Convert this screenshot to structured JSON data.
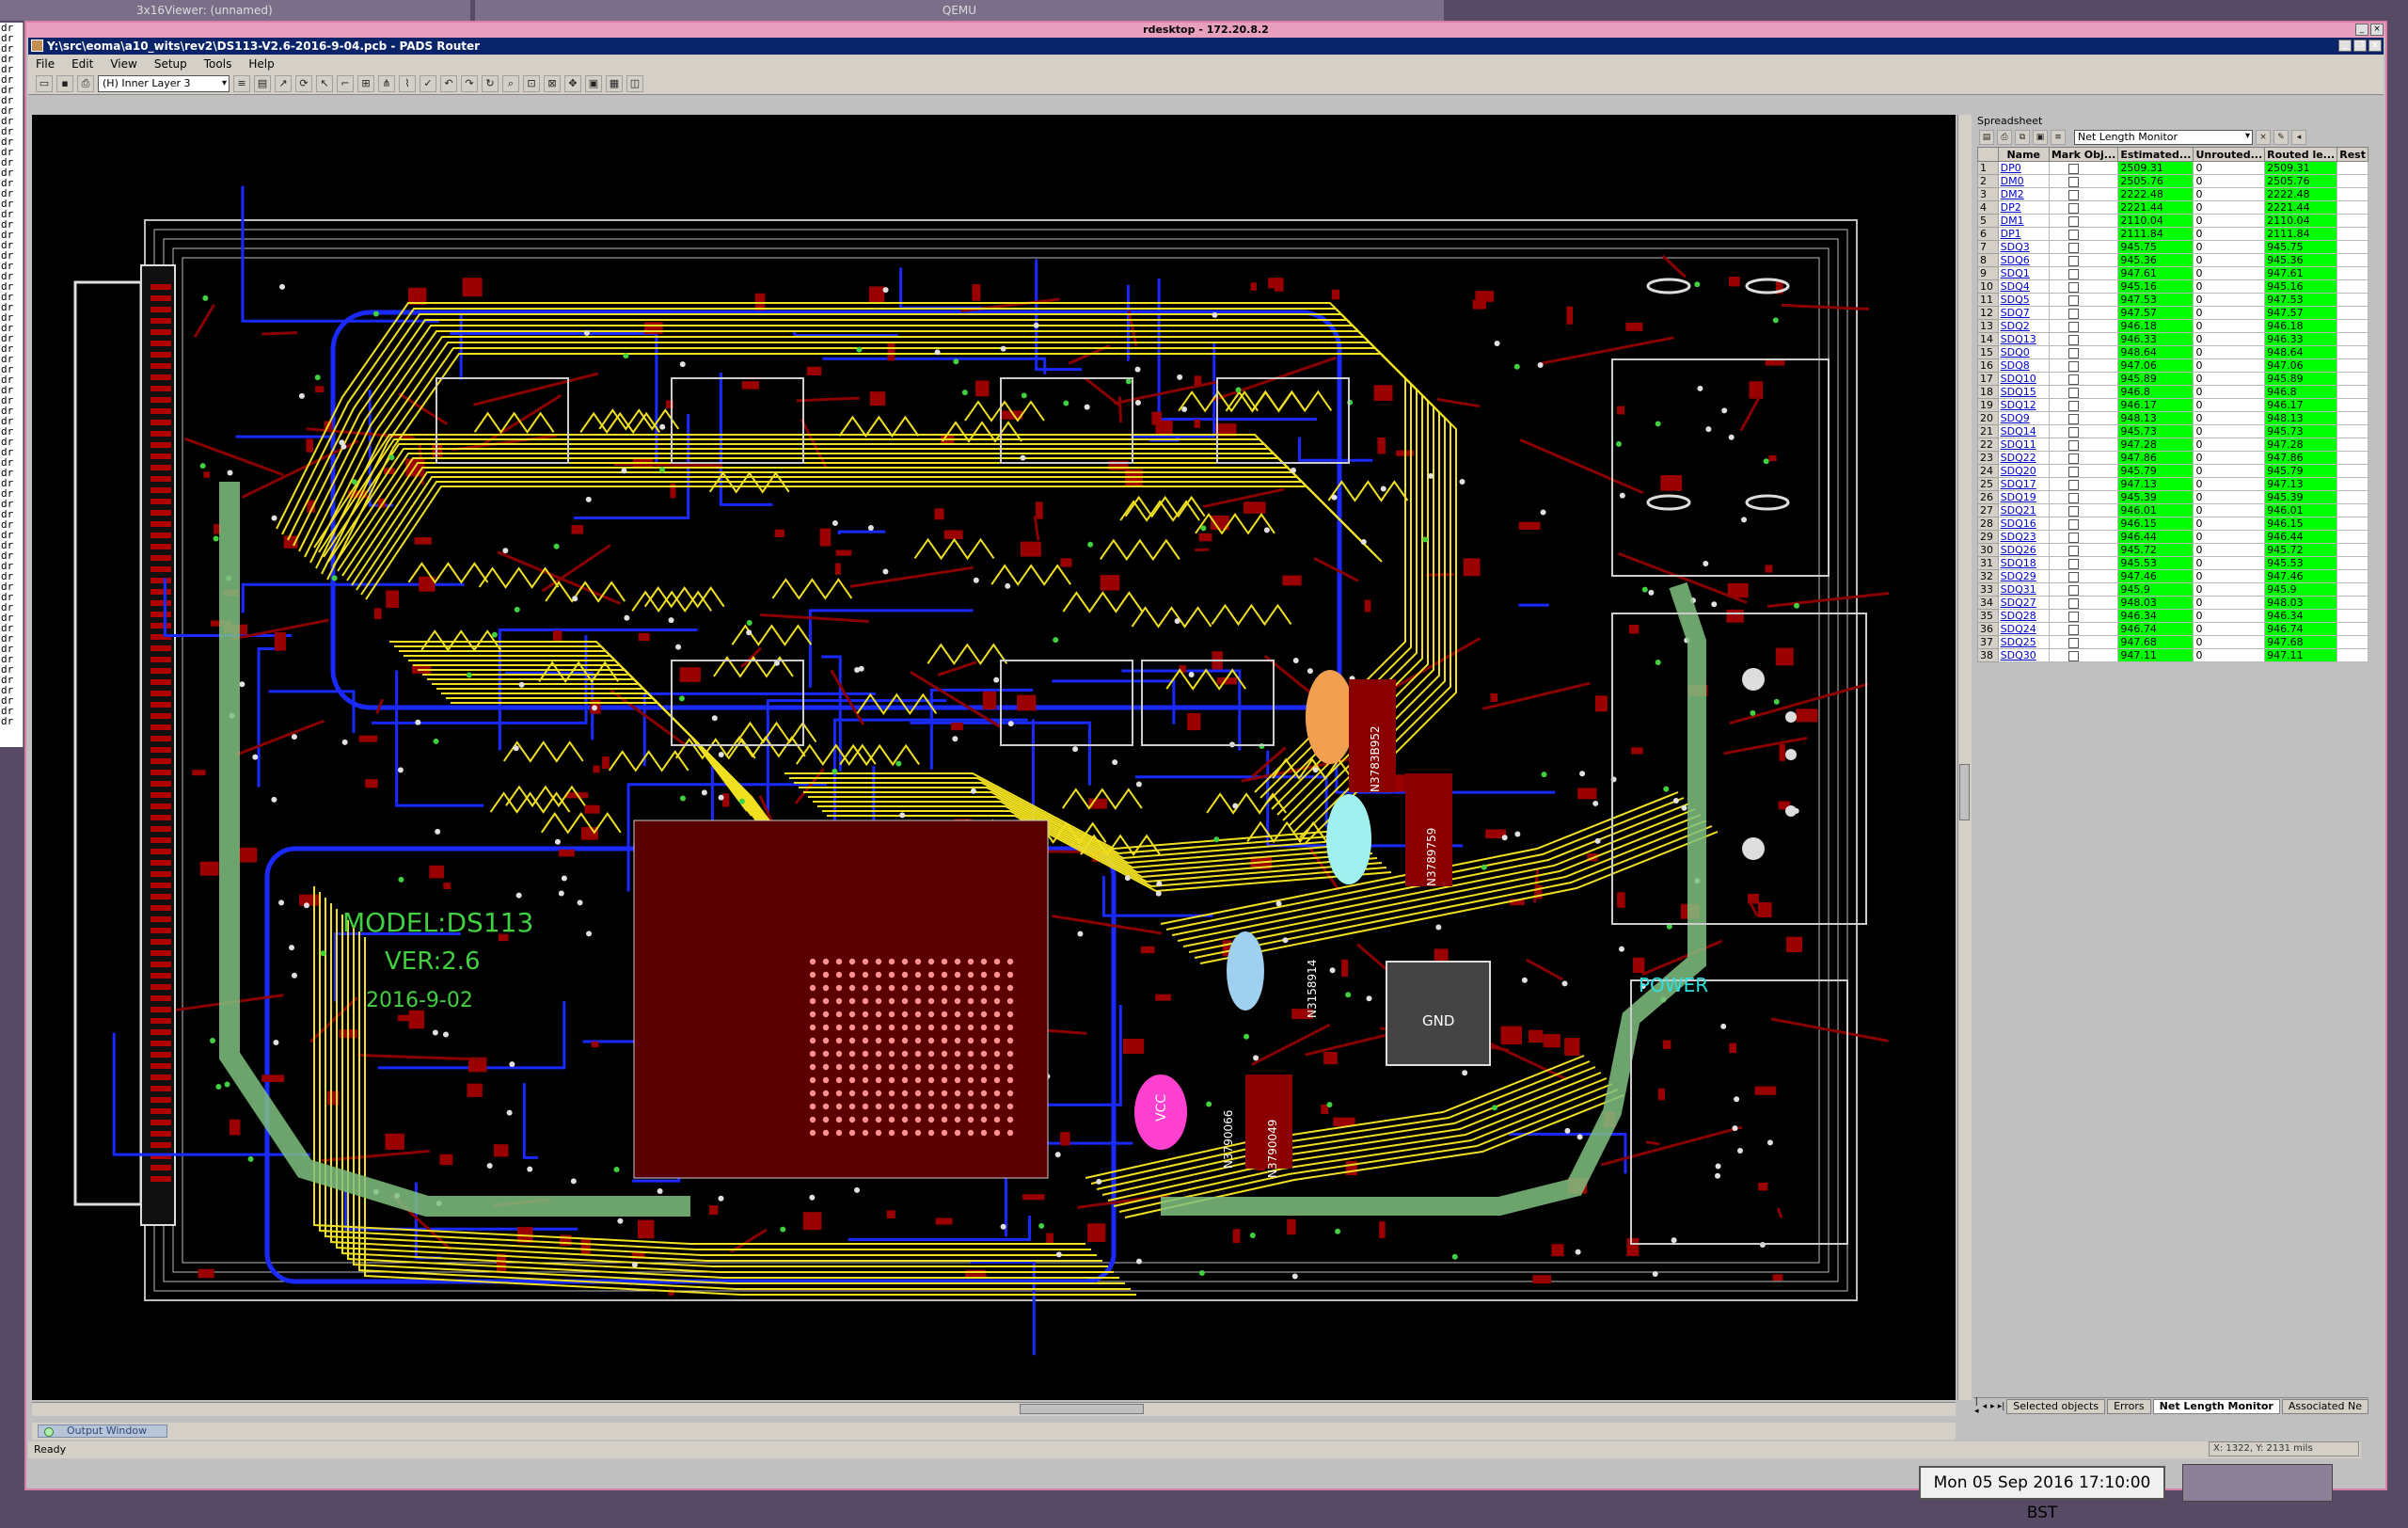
{
  "desktop": {
    "bg_title_left": "3x16Viewer: (unnamed)",
    "bg_title_mid": "QEMU",
    "xterm_lines": [
      "dr",
      "dr",
      "dr",
      "dr",
      "dr",
      "dr",
      "dr",
      "dr",
      "dr",
      "dr",
      "dr",
      "dr",
      "dr",
      "dr",
      "dr",
      "dr",
      "dr",
      "dr",
      "dr",
      "dr",
      "dr",
      "dr",
      "dr",
      "dr",
      "dr",
      "dr",
      "dr",
      "dr",
      "dr",
      "dr",
      "dr",
      "dr",
      "dr",
      "dr",
      "dr",
      "dr",
      "dr",
      "dr",
      "dr",
      "dr",
      "dr",
      "dr",
      "dr",
      "dr",
      "dr",
      "dr",
      "dr",
      "dr",
      "dr",
      "dr",
      "dr",
      "dr",
      "dr",
      "dr",
      "dr",
      "dr",
      "dr",
      "dr",
      "dr",
      "dr",
      "dr",
      "dr",
      "dr",
      "dr",
      "dr",
      "dr",
      "dr",
      "dr"
    ]
  },
  "rdesktop": {
    "title": "rdesktop - 172.20.8.2"
  },
  "app": {
    "title": "Y:\\src\\eoma\\a10_wits\\rev2\\DS113-V2.6-2016-9-04.pcb - PADS Router",
    "menu": [
      "File",
      "Edit",
      "View",
      "Setup",
      "Tools",
      "Help"
    ],
    "layer": "(H) Inner Layer 3",
    "status": "Ready",
    "coords": "X: 1322,  Y: 2131   mils",
    "output_tab": "Output Window"
  },
  "board": {
    "silk_model": "MODEL:DS113",
    "silk_ver": "VER:2.6",
    "silk_date": "2016-9-02",
    "power": "POWER",
    "gnd": "GND",
    "vcc": "VCC",
    "ref1": "N3783B952",
    "ref2": "N3789759",
    "ref3": "N3158914",
    "ref4": "N3790066",
    "ref5": "N3790049"
  },
  "spreadsheet": {
    "panel_title": "Spreadsheet",
    "monitor": "Net Length Monitor",
    "columns": [
      "Name",
      "Mark Obj...",
      "Estimated...",
      "Unrouted...",
      "Routed le...",
      "Rest"
    ],
    "rows": [
      [
        "1",
        "DP0",
        "2509.31",
        "0",
        "2509.31"
      ],
      [
        "2",
        "DM0",
        "2505.76",
        "0",
        "2505.76"
      ],
      [
        "3",
        "DM2",
        "2222.48",
        "0",
        "2222.48"
      ],
      [
        "4",
        "DP2",
        "2221.44",
        "0",
        "2221.44"
      ],
      [
        "5",
        "DM1",
        "2110.04",
        "0",
        "2110.04"
      ],
      [
        "6",
        "DP1",
        "2111.84",
        "0",
        "2111.84"
      ],
      [
        "7",
        "SDQ3",
        "945.75",
        "0",
        "945.75"
      ],
      [
        "8",
        "SDQ6",
        "945.36",
        "0",
        "945.36"
      ],
      [
        "9",
        "SDQ1",
        "947.61",
        "0",
        "947.61"
      ],
      [
        "10",
        "SDQ4",
        "945.16",
        "0",
        "945.16"
      ],
      [
        "11",
        "SDQ5",
        "947.53",
        "0",
        "947.53"
      ],
      [
        "12",
        "SDQ7",
        "947.57",
        "0",
        "947.57"
      ],
      [
        "13",
        "SDQ2",
        "946.18",
        "0",
        "946.18"
      ],
      [
        "14",
        "SDQ13",
        "946.33",
        "0",
        "946.33"
      ],
      [
        "15",
        "SDQ0",
        "948.64",
        "0",
        "948.64"
      ],
      [
        "16",
        "SDQ8",
        "947.06",
        "0",
        "947.06"
      ],
      [
        "17",
        "SDQ10",
        "945.89",
        "0",
        "945.89"
      ],
      [
        "18",
        "SDQ15",
        "946.8",
        "0",
        "946.8"
      ],
      [
        "19",
        "SDQ12",
        "946.17",
        "0",
        "946.17"
      ],
      [
        "20",
        "SDQ9",
        "948.13",
        "0",
        "948.13"
      ],
      [
        "21",
        "SDQ14",
        "945.73",
        "0",
        "945.73"
      ],
      [
        "22",
        "SDQ11",
        "947.28",
        "0",
        "947.28"
      ],
      [
        "23",
        "SDQ22",
        "947.86",
        "0",
        "947.86"
      ],
      [
        "24",
        "SDQ20",
        "945.79",
        "0",
        "945.79"
      ],
      [
        "25",
        "SDQ17",
        "947.13",
        "0",
        "947.13"
      ],
      [
        "26",
        "SDQ19",
        "945.39",
        "0",
        "945.39"
      ],
      [
        "27",
        "SDQ21",
        "946.01",
        "0",
        "946.01"
      ],
      [
        "28",
        "SDQ16",
        "946.15",
        "0",
        "946.15"
      ],
      [
        "29",
        "SDQ23",
        "946.44",
        "0",
        "946.44"
      ],
      [
        "30",
        "SDQ26",
        "945.72",
        "0",
        "945.72"
      ],
      [
        "31",
        "SDQ18",
        "945.53",
        "0",
        "945.53"
      ],
      [
        "32",
        "SDQ29",
        "947.46",
        "0",
        "947.46"
      ],
      [
        "33",
        "SDQ31",
        "945.9",
        "0",
        "945.9"
      ],
      [
        "34",
        "SDQ27",
        "948.03",
        "0",
        "948.03"
      ],
      [
        "35",
        "SDQ28",
        "946.34",
        "0",
        "946.34"
      ],
      [
        "36",
        "SDQ24",
        "946.74",
        "0",
        "946.74"
      ],
      [
        "37",
        "SDQ25",
        "947.68",
        "0",
        "947.68"
      ],
      [
        "38",
        "SDQ30",
        "947.11",
        "0",
        "947.11"
      ]
    ],
    "tabs": [
      "Selected objects",
      "Errors",
      "Net Length Monitor",
      "Associated Ne"
    ],
    "active_tab": "Net Length Monitor"
  },
  "clock": "Mon 05 Sep 2016 17:10:00 BST",
  "colors": {
    "titlebar": "#0a246a",
    "trace_yellow": "#f0e020",
    "trace_blue": "#1a2aff",
    "copper_red": "#8a0000",
    "net_ok_green": "#00ff00"
  }
}
